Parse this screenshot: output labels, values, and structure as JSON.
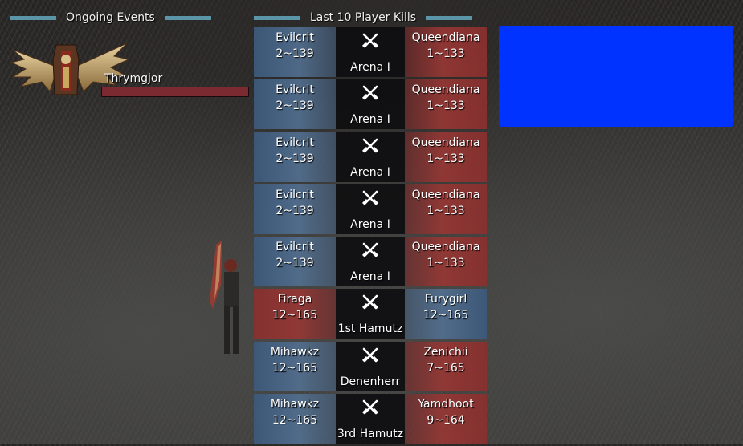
{
  "headers": {
    "events_title": "Ongoing Events",
    "kills_title": "Last 10 Player Kills"
  },
  "event": {
    "name": "Thrymgjor",
    "emblem_icon": "winged-skull-emblem-icon"
  },
  "kill_icon": "crossed-swords-icon",
  "kills": [
    {
      "killer": "Evilcrit",
      "killer_level": "2~139",
      "killer_side": "blue",
      "place": "Arena I",
      "victim": "Queendiana",
      "victim_level": "1~133",
      "victim_side": "red"
    },
    {
      "killer": "Evilcrit",
      "killer_level": "2~139",
      "killer_side": "blue",
      "place": "Arena I",
      "victim": "Queendiana",
      "victim_level": "1~133",
      "victim_side": "red"
    },
    {
      "killer": "Evilcrit",
      "killer_level": "2~139",
      "killer_side": "blue",
      "place": "Arena I",
      "victim": "Queendiana",
      "victim_level": "1~133",
      "victim_side": "red"
    },
    {
      "killer": "Evilcrit",
      "killer_level": "2~139",
      "killer_side": "blue",
      "place": "Arena I",
      "victim": "Queendiana",
      "victim_level": "1~133",
      "victim_side": "red"
    },
    {
      "killer": "Evilcrit",
      "killer_level": "2~139",
      "killer_side": "blue",
      "place": "Arena I",
      "victim": "Queendiana",
      "victim_level": "1~133",
      "victim_side": "red"
    },
    {
      "killer": "Firaga",
      "killer_level": "12~165",
      "killer_side": "red",
      "place": "1st Hamutz",
      "victim": "Furygirl",
      "victim_level": "12~165",
      "victim_side": "blue"
    },
    {
      "killer": "Mihawkz",
      "killer_level": "12~165",
      "killer_side": "blue",
      "place": "Denenherr",
      "victim": "Zenichii",
      "victim_level": "7~165",
      "victim_side": "red"
    },
    {
      "killer": "Mihawkz",
      "killer_level": "12~165",
      "killer_side": "blue",
      "place": "3rd Hamutz",
      "victim": "Yamdhoot",
      "victim_level": "9~164",
      "victim_side": "red"
    }
  ],
  "colors": {
    "header_bar": "#5b95a8",
    "blue_overlay": "#0033ff",
    "faction_blue": "#52708f",
    "faction_red": "#963734"
  }
}
